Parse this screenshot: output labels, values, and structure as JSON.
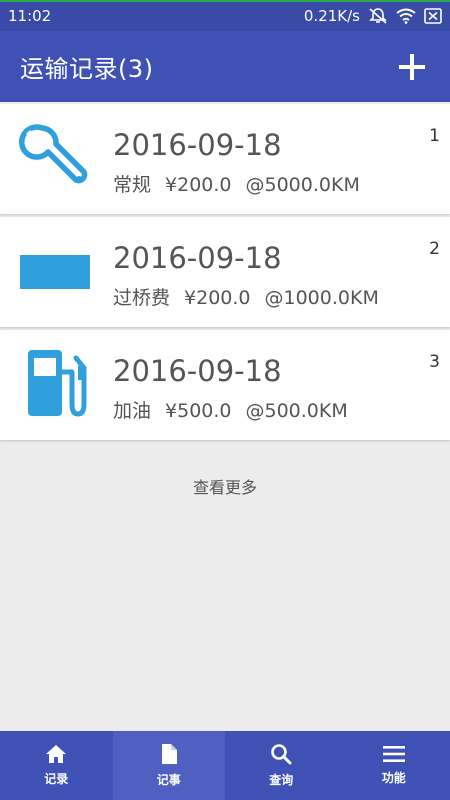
{
  "status_bar": {
    "time": "11:02",
    "net_speed": "0.21K/s",
    "icons": [
      "notification-off-icon",
      "wifi-icon",
      "sim-icon"
    ]
  },
  "app_bar": {
    "title": "运输记录(3)",
    "add_icon": "plus-icon"
  },
  "records": [
    {
      "index": "1",
      "date": "2016-09-18",
      "category": "常规",
      "amount": "¥200.0",
      "mileage": "@5000.0KM",
      "icon": "wrench-icon"
    },
    {
      "index": "2",
      "date": "2016-09-18",
      "category": "过桥费",
      "amount": "¥200.0",
      "mileage": "@1000.0KM",
      "icon": "bridge-toll-icon"
    },
    {
      "index": "3",
      "date": "2016-09-18",
      "category": "加油",
      "amount": "¥500.0",
      "mileage": "@500.0KM",
      "icon": "fuel-pump-icon"
    }
  ],
  "more_label": "查看更多",
  "bottom_nav": {
    "items": [
      {
        "label": "记录",
        "icon": "home-icon",
        "active": false
      },
      {
        "label": "记事",
        "icon": "document-icon",
        "active": true
      },
      {
        "label": "查询",
        "icon": "search-icon",
        "active": false
      },
      {
        "label": "功能",
        "icon": "menu-icon",
        "active": false
      }
    ]
  },
  "colors": {
    "primary": "#3f51b5",
    "status_bar": "#3a4aa7",
    "icon_blue": "#2f9fde",
    "background": "#ececec"
  }
}
